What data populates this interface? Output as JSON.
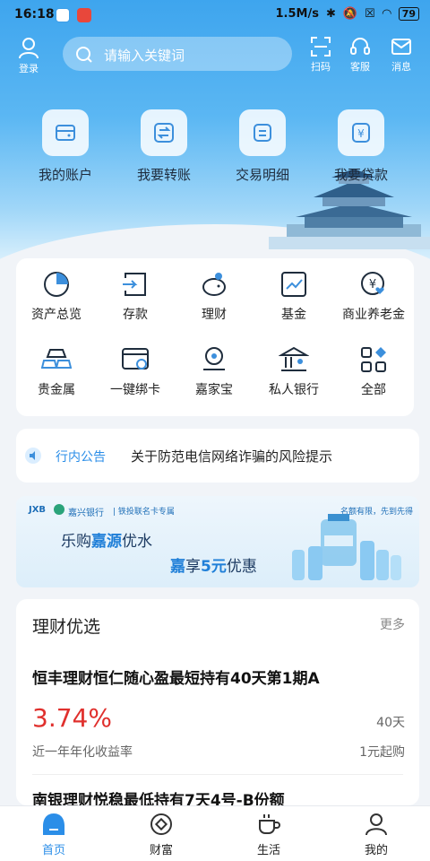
{
  "status_bar": {
    "time": "16:18",
    "net_speed": "1.5M/s",
    "battery": "79"
  },
  "top_bar": {
    "login_label": "登录",
    "search_placeholder": "请输入关键词",
    "scan_label": "扫码",
    "service_label": "客服",
    "message_label": "消息"
  },
  "quick_actions": [
    {
      "label": "我的账户",
      "icon": "wallet-icon"
    },
    {
      "label": "我要转账",
      "icon": "transfer-icon"
    },
    {
      "label": "交易明细",
      "icon": "statement-icon"
    },
    {
      "label": "我要贷款",
      "icon": "loan-icon"
    }
  ],
  "services": [
    {
      "label": "资产总览",
      "icon": "pie-chart-icon"
    },
    {
      "label": "存款",
      "icon": "deposit-icon"
    },
    {
      "label": "理财",
      "icon": "piggy-bank-icon"
    },
    {
      "label": "基金",
      "icon": "fund-chart-icon"
    },
    {
      "label": "商业养老金",
      "icon": "pension-icon"
    },
    {
      "label": "贵金属",
      "icon": "gold-bars-icon"
    },
    {
      "label": "一键绑卡",
      "icon": "bind-card-icon"
    },
    {
      "label": "嘉家宝",
      "icon": "jiajiabao-icon"
    },
    {
      "label": "私人银行",
      "icon": "private-bank-icon"
    },
    {
      "label": "全部",
      "icon": "all-grid-icon"
    }
  ],
  "notice": {
    "tag": "行内公告",
    "text": "关于防范电信网络诈骗的风险提示"
  },
  "banner": {
    "brand": "JXB",
    "bank": "嘉兴银行",
    "card_note": "| 铁投联名卡专属",
    "slogan_right": "名额有限，先到先得",
    "line1_a": "乐购",
    "line1_b": "嘉源",
    "line1_c": "优水",
    "line2_a": "嘉",
    "line2_b": "享",
    "line2_c": "5元",
    "line2_d": "优惠"
  },
  "finance": {
    "title": "理财优选",
    "more": "更多",
    "product_name": "恒丰理财恒仁随心盈最短持有40天第1期A",
    "rate": "3.74%",
    "rate_label": "近一年年化收益率",
    "term": "40天",
    "min_buy": "1元起购",
    "next_product": "南银理财悦稳最低持有7天4号-B份额"
  },
  "tabs": [
    {
      "label": "首页",
      "icon": "home-icon",
      "active": true
    },
    {
      "label": "财富",
      "icon": "wealth-icon",
      "active": false
    },
    {
      "label": "生活",
      "icon": "coffee-icon",
      "active": false
    },
    {
      "label": "我的",
      "icon": "profile-icon",
      "active": false
    }
  ],
  "colors": {
    "primary": "#2b8ee8",
    "rate_red": "#e0302d"
  }
}
